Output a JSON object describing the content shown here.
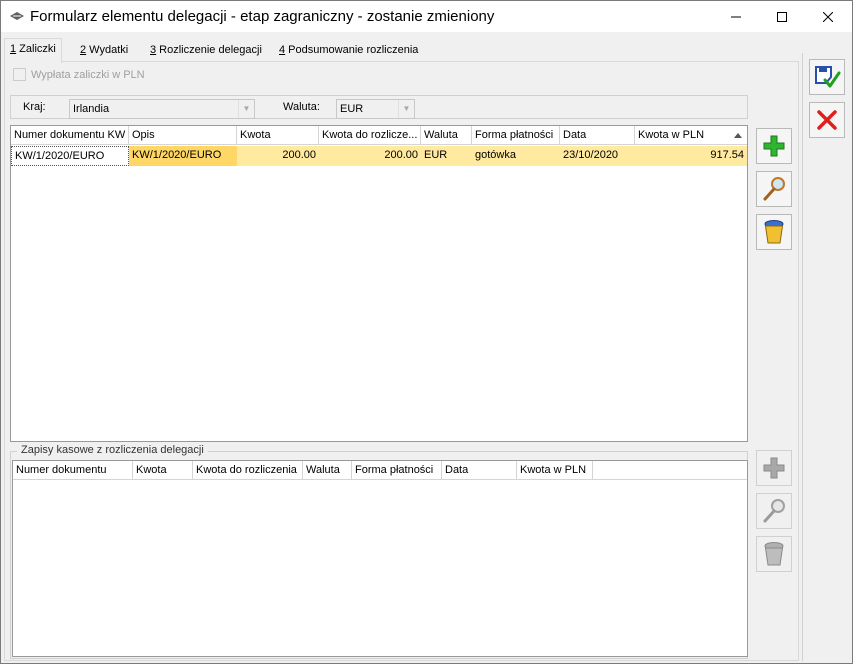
{
  "window": {
    "title": "Formularz elementu delegacji - etap zagraniczny - zostanie zmieniony"
  },
  "tabs": [
    {
      "key": "1",
      "label": " Zaliczki"
    },
    {
      "key": "2",
      "label": " Wydatki"
    },
    {
      "key": "3",
      "label": " Rozliczenie delegacji"
    },
    {
      "key": "4",
      "label": " Podsumowanie rozliczenia"
    }
  ],
  "checkbox": {
    "label": "Wypłata zaliczki w PLN",
    "checked": false
  },
  "filter": {
    "country_label": "Kraj:",
    "country_value": "Irlandia",
    "currency_label": "Waluta:",
    "currency_value": "EUR"
  },
  "advances_grid": {
    "columns": [
      "Numer dokumentu KW",
      "Opis",
      "Kwota",
      "Kwota do rozlicze...",
      "Waluta",
      "Forma płatności",
      "Data",
      "Kwota w PLN"
    ],
    "rows": [
      {
        "numer": "KW/1/2020/EURO",
        "opis": "KW/1/2020/EURO",
        "kwota": "200.00",
        "do_rozliczenia": "200.00",
        "waluta": "EUR",
        "forma": "gotówka",
        "data": "23/10/2020",
        "kwota_pln": "917.54"
      }
    ]
  },
  "cash_group": {
    "legend": "Zapisy kasowe z rozliczenia delegacji",
    "columns": [
      "Numer dokumentu",
      "Kwota",
      "Kwota do rozliczenia",
      "Waluta",
      "Forma płatności",
      "Data",
      "Kwota w PLN"
    ]
  },
  "colors": {
    "selected_row": "#ffeaa0",
    "selected_cell": "#ffd766",
    "add_green": "#2fb52f",
    "cancel_red": "#e0201c"
  }
}
